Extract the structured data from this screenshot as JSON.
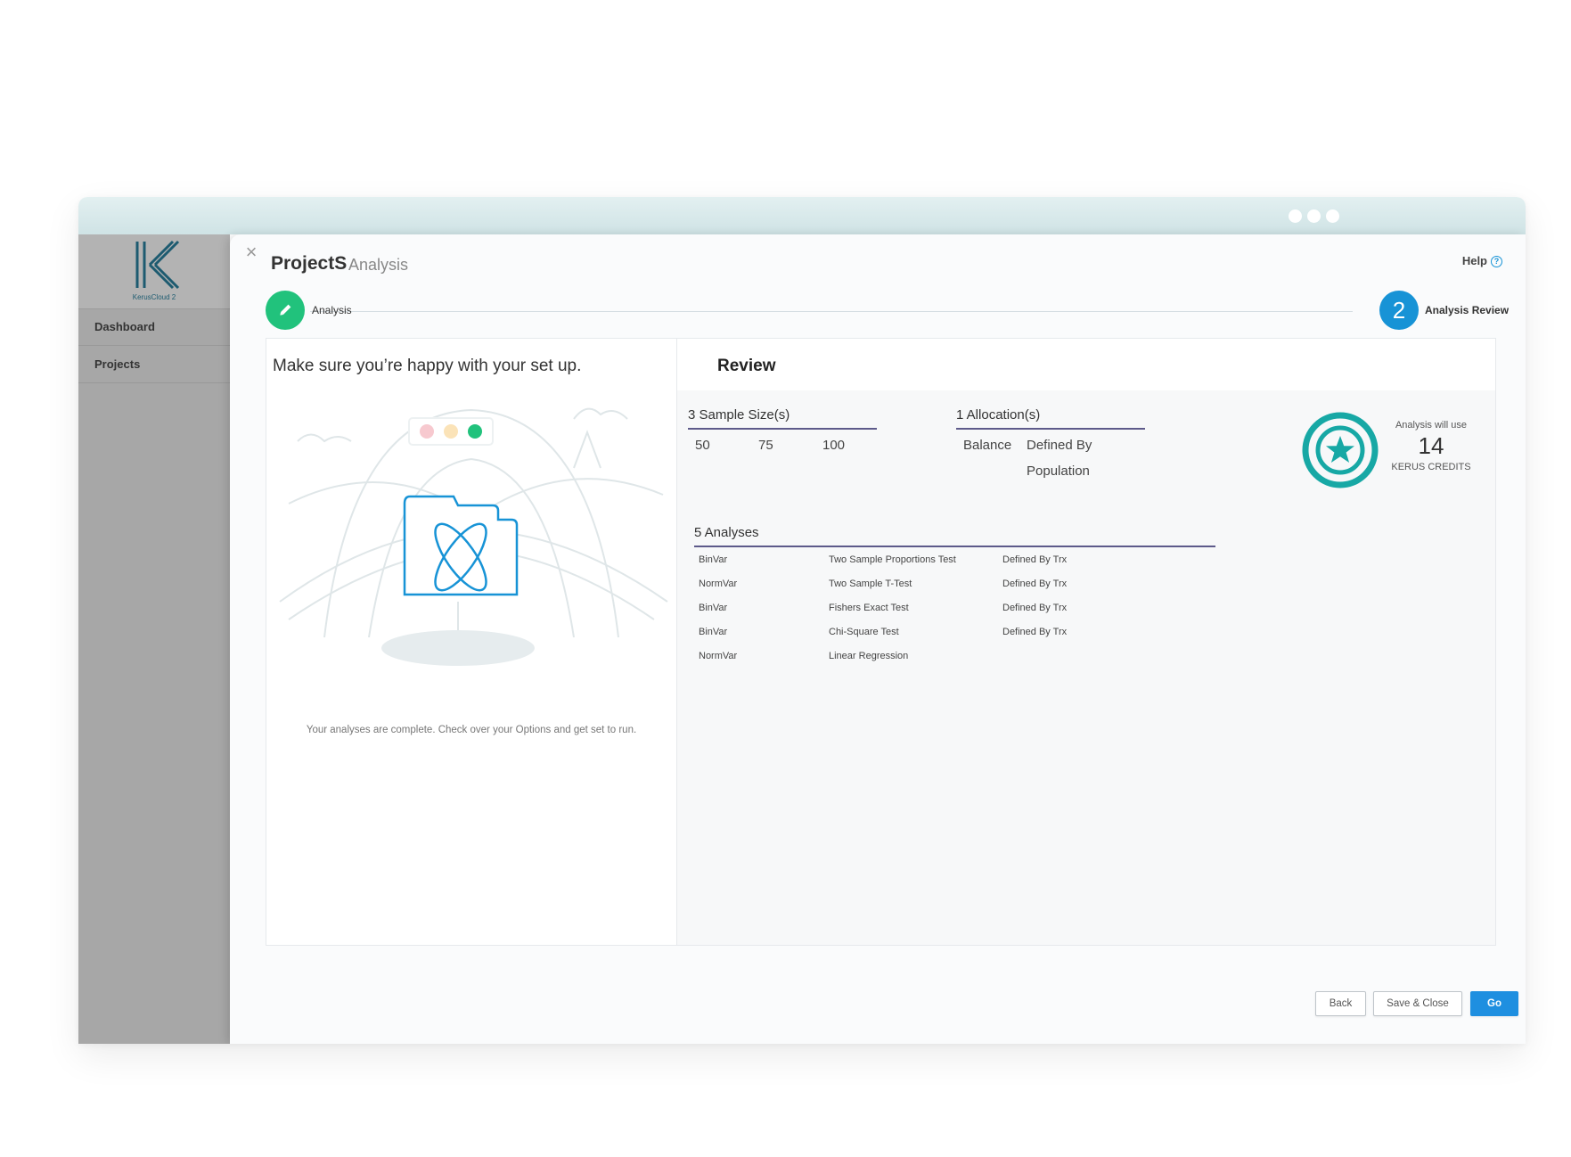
{
  "brand": {
    "logo_text": "KerusCloud 2"
  },
  "sidebar": {
    "items": [
      {
        "label": "Dashboard"
      },
      {
        "label": "Projects"
      }
    ]
  },
  "header": {
    "project_name": "ProjectS",
    "section": "Analysis",
    "help_label": "Help"
  },
  "stepper": {
    "steps": [
      {
        "label": "Analysis",
        "status": "complete",
        "icon": "pencil-icon"
      },
      {
        "label": "Analysis Review",
        "number": "2",
        "status": "active"
      }
    ]
  },
  "left": {
    "heading": "Make sure you’re happy with your set up.",
    "caption": "Your analyses are complete. Check over your Options and get set to run."
  },
  "review": {
    "title": "Review",
    "sample_sizes": {
      "title": "3 Sample Size(s)",
      "values": [
        "50",
        "75",
        "100"
      ]
    },
    "allocations": {
      "title": "1 Allocation(s)",
      "type": "Balance",
      "value_line1": "Defined By",
      "value_line2": "Population"
    },
    "analyses": {
      "title": "5 Analyses",
      "rows": [
        {
          "variable": "BinVar",
          "test": "Two Sample Proportions Test",
          "defined": "Defined By Trx"
        },
        {
          "variable": "NormVar",
          "test": "Two Sample T-Test",
          "defined": "Defined By Trx"
        },
        {
          "variable": "BinVar",
          "test": "Fishers Exact Test",
          "defined": "Defined By Trx"
        },
        {
          "variable": "BinVar",
          "test": "Chi-Square Test",
          "defined": "Defined By Trx"
        },
        {
          "variable": "NormVar",
          "test": "Linear Regression",
          "defined": ""
        }
      ]
    },
    "credits": {
      "label_top": "Analysis will use",
      "amount": "14",
      "label_bottom": "KERUS CREDITS",
      "icon": "star-badge-icon"
    }
  },
  "footer": {
    "back_label": "Back",
    "save_close_label": "Save & Close",
    "go_label": "Go"
  },
  "colors": {
    "accent": "#1e8fe0",
    "success": "#21c27c",
    "teal": "#17a8a5",
    "rule": "#5d5a8a"
  }
}
